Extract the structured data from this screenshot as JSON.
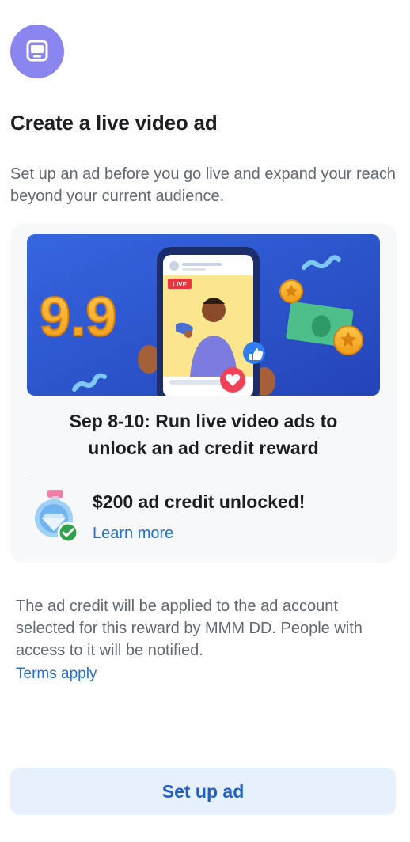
{
  "header": {
    "icon": "ad-monitor-icon",
    "title": "Create a live video ad",
    "subtitle": "Set up an ad before you go live and expand your reach beyond your current audience."
  },
  "promo": {
    "banner": {
      "badge_text": "9.9",
      "live_label": "LIVE"
    },
    "heading_line1": "Sep 8-10: Run live video ads to",
    "heading_line2": "unlock an ad credit reward",
    "reward": {
      "icon": "diamond-medal-check-icon",
      "title": "$200 ad credit unlocked!",
      "link_label": "Learn more"
    }
  },
  "footer_note": {
    "text": "The ad credit will be applied to the ad account selected for this reward by MMM DD. People with access to it will be notified.",
    "terms_label": "Terms apply"
  },
  "primary_action": {
    "label": "Set up ad"
  },
  "colors": {
    "accent_blue": "#216fdb",
    "button_bg": "#e7f0fd",
    "icon_bg": "#8b85f0",
    "banner_bg": "#2d55d6"
  }
}
